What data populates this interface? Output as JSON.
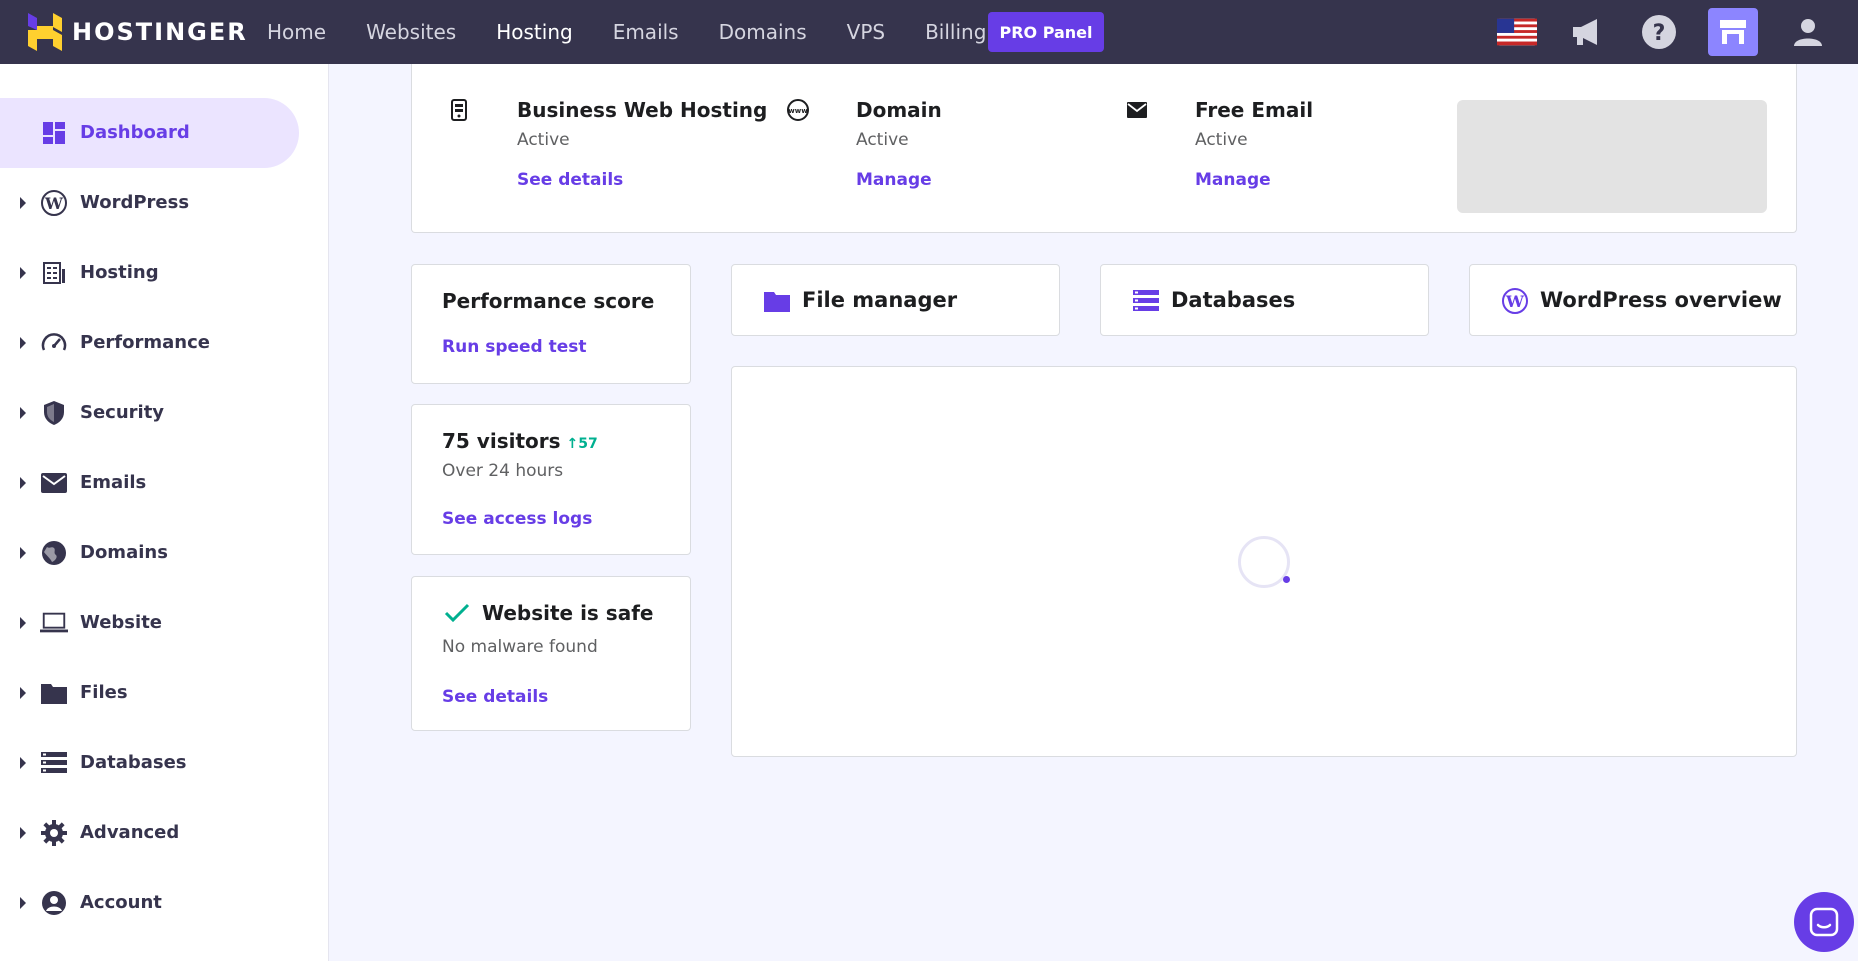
{
  "app": {
    "brand": "HOSTINGER"
  },
  "nav": {
    "items": [
      "Home",
      "Websites",
      "Hosting",
      "Emails",
      "Domains",
      "VPS",
      "Billing"
    ],
    "active": "Hosting",
    "pro_button": "PRO Panel"
  },
  "top_icons": [
    "us-flag-icon",
    "megaphone-icon",
    "help-icon",
    "store-icon",
    "user-icon"
  ],
  "sidebar": {
    "items": [
      {
        "label": "Dashboard",
        "icon": "dashboard-icon",
        "active": true
      },
      {
        "label": "WordPress",
        "icon": "wordpress-icon"
      },
      {
        "label": "Hosting",
        "icon": "hosting-icon"
      },
      {
        "label": "Performance",
        "icon": "gauge-icon"
      },
      {
        "label": "Security",
        "icon": "shield-icon"
      },
      {
        "label": "Emails",
        "icon": "envelope-icon"
      },
      {
        "label": "Domains",
        "icon": "globe-icon"
      },
      {
        "label": "Website",
        "icon": "laptop-icon"
      },
      {
        "label": "Files",
        "icon": "folder-icon"
      },
      {
        "label": "Databases",
        "icon": "database-icon"
      },
      {
        "label": "Advanced",
        "icon": "gear-icon"
      },
      {
        "label": "Account",
        "icon": "account-icon"
      }
    ]
  },
  "services": [
    {
      "title": "Business Web Hosting",
      "status": "Active",
      "link": "See details",
      "icon": "server-icon"
    },
    {
      "title": "Domain",
      "status": "Active",
      "link": "Manage",
      "icon": "www-icon"
    },
    {
      "title": "Free Email",
      "status": "Active",
      "link": "Manage",
      "icon": "mail-icon"
    }
  ],
  "performance": {
    "title": "Performance score",
    "link": "Run speed test"
  },
  "visitors": {
    "title": "75 visitors",
    "trend": "57",
    "sub": "Over 24 hours",
    "link": "See access logs"
  },
  "safety": {
    "title": "Website is safe",
    "sub": "No malware found",
    "link": "See details"
  },
  "quick_links": [
    {
      "label": "File manager",
      "icon": "folder-icon"
    },
    {
      "label": "Databases",
      "icon": "database-icon"
    },
    {
      "label": "WordPress overview",
      "icon": "wordpress-icon"
    }
  ],
  "colors": {
    "topbar": "#36344d",
    "accent": "#673de6",
    "success": "#00b090",
    "active_bg": "#ebe4ff"
  }
}
